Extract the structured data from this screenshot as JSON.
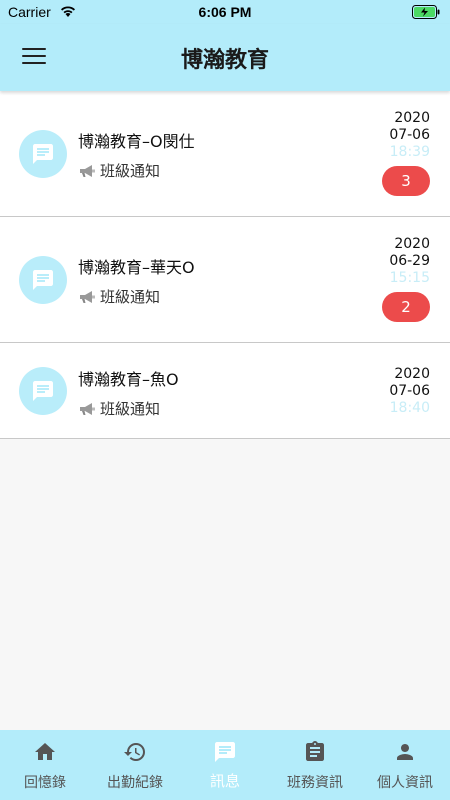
{
  "status_bar": {
    "carrier": "Carrier",
    "time": "6:06 PM"
  },
  "app_bar": {
    "title": "博瀚教育"
  },
  "messages": [
    {
      "title": "博瀚教育–O閔仕",
      "subtitle": "班級通知",
      "date_year": "2020",
      "date_md": "07-06",
      "time": "18:39",
      "unread": "3"
    },
    {
      "title": "博瀚教育–華天O",
      "subtitle": "班級通知",
      "date_year": "2020",
      "date_md": "06-29",
      "time": "15:15",
      "unread": "2"
    },
    {
      "title": "博瀚教育–魚O",
      "subtitle": "班級通知",
      "date_year": "2020",
      "date_md": "07-06",
      "time": "18:40",
      "unread": ""
    }
  ],
  "bottom_nav": [
    {
      "label": "回憶錄",
      "icon": "home-icon",
      "active": false
    },
    {
      "label": "出勤紀錄",
      "icon": "history-icon",
      "active": false
    },
    {
      "label": "訊息",
      "icon": "message-icon",
      "active": true
    },
    {
      "label": "班務資訊",
      "icon": "clipboard-icon",
      "active": false
    },
    {
      "label": "個人資訊",
      "icon": "person-icon",
      "active": false
    }
  ],
  "colors": {
    "bar_background": "#b3ecfa",
    "avatar_background": "#b9edfa",
    "badge": "#ec4b4b",
    "time_text": "#c8edf7"
  }
}
